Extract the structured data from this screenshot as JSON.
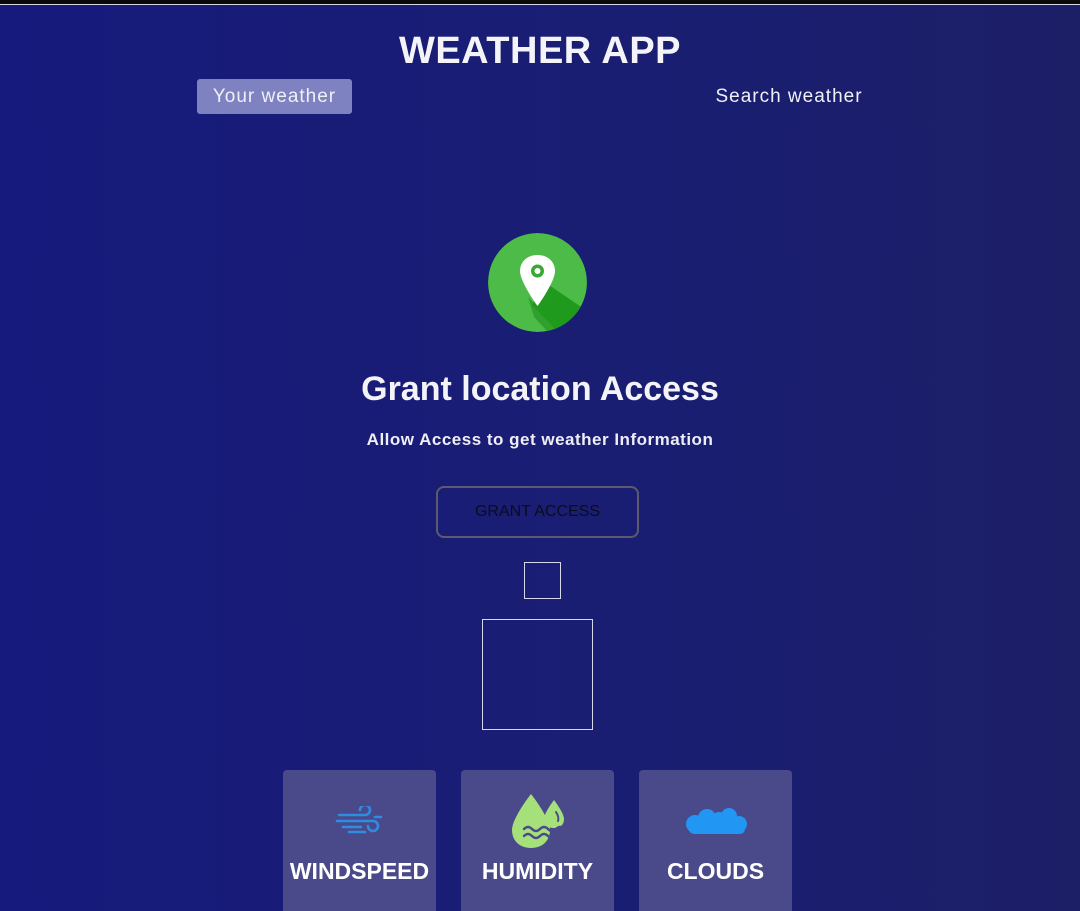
{
  "header": {
    "title": "WEATHER APP"
  },
  "tabs": [
    {
      "label": "Your weather",
      "active": true
    },
    {
      "label": "Search weather",
      "active": false
    }
  ],
  "grant": {
    "icon": "location-pin-icon",
    "title": "Grant location Access",
    "subtitle": "Allow Access to get weather Information",
    "button_label": "GRANT ACCESS"
  },
  "cards": [
    {
      "label": "WINDSPEED",
      "icon": "wind-icon"
    },
    {
      "label": "HUMIDITY",
      "icon": "humidity-drops-icon"
    },
    {
      "label": "CLOUDS",
      "icon": "cloud-icon"
    }
  ],
  "colors": {
    "background": "#161a7c",
    "active_tab": "#7f82c0",
    "card": "#4a4a8a",
    "pin_green": "#4cbb47",
    "wind_blue": "#2d8de0",
    "cloud_blue": "#2196f3"
  }
}
